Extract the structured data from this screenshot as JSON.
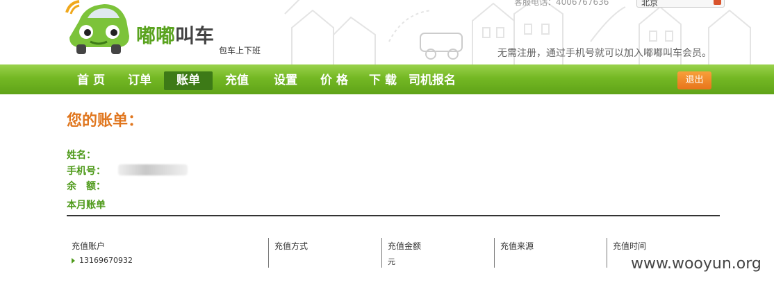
{
  "header": {
    "brand_green": "嘟嘟",
    "brand_dark": "叫车",
    "slogan": "包车上下班",
    "hotline": "客服电话：4006767636",
    "city": "北京",
    "promo": "无需注册，通过手机号就可以加入嘟嘟叫车会员。"
  },
  "nav": {
    "items": [
      "首 页",
      "订单",
      "账单",
      "充值",
      "设置",
      "价 格",
      "下 载",
      "司机报名"
    ],
    "active_index": 2,
    "logout": "退出"
  },
  "content": {
    "title": "您的账单：",
    "name_label": "姓名：",
    "phone_label": "手机号：",
    "balance_label": "余　额：",
    "month_label": "本月账单"
  },
  "table": {
    "headers": [
      "充值账户",
      "充值方式",
      "充值金额",
      "充值来源",
      "充值时间"
    ],
    "row": {
      "account": "13169670932",
      "method": "",
      "amount": "元",
      "source": "",
      "time": ""
    }
  },
  "watermark": "www.wooyun.org",
  "colors": {
    "brand_green": "#5aa31f",
    "nav_green": "#74b824",
    "nav_active": "#3d7a17",
    "title_orange": "#e0761e",
    "logout_orange": "#e8741b"
  }
}
